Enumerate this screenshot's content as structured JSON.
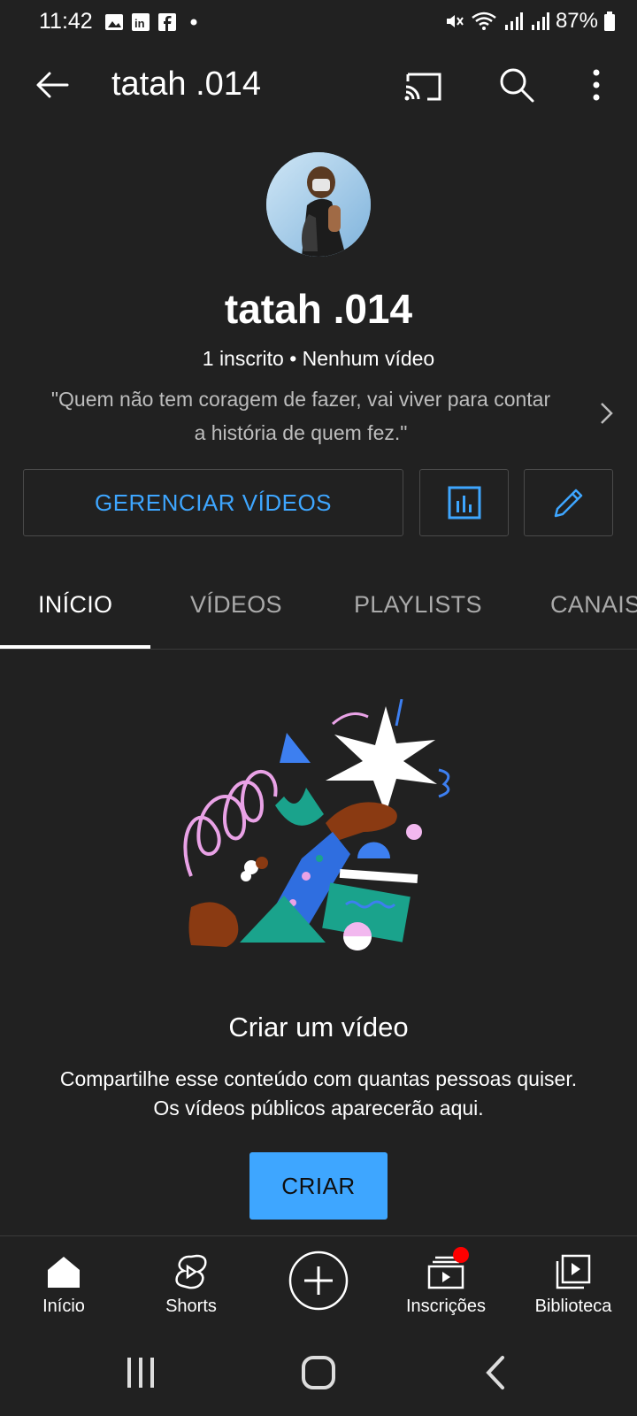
{
  "status_bar": {
    "time": "11:42",
    "battery": "87%",
    "left_icons": [
      "gallery-icon",
      "linkedin-icon",
      "facebook-icon",
      "dot-icon"
    ],
    "right_icons": [
      "mute-icon",
      "wifi-icon",
      "signal-icon",
      "signal-icon",
      "battery-icon"
    ]
  },
  "app_bar": {
    "title": "tatah .014"
  },
  "channel": {
    "name": "tatah .014",
    "meta": "1 inscrito • Nenhum vídeo",
    "description_line1": "\"Quem não tem coragem de fazer, vai viver para contar",
    "description_line2": "a história de quem fez.\""
  },
  "actions": {
    "manage_label": "GERENCIAR VÍDEOS"
  },
  "tabs": [
    {
      "label": "INÍCIO",
      "active": true
    },
    {
      "label": "VÍDEOS",
      "active": false
    },
    {
      "label": "PLAYLISTS",
      "active": false
    },
    {
      "label": "CANAIS",
      "active": false
    }
  ],
  "empty_state": {
    "title": "Criar um vídeo",
    "line1": "Compartilhe esse conteúdo com quantas pessoas quiser.",
    "line2": "Os vídeos públicos aparecerão aqui.",
    "button": "CRIAR"
  },
  "bottom_nav": {
    "items": [
      {
        "label": "Início",
        "icon": "home-icon"
      },
      {
        "label": "Shorts",
        "icon": "shorts-icon"
      },
      {
        "label": "",
        "icon": "create-plus-icon"
      },
      {
        "label": "Inscrições",
        "icon": "subscriptions-icon"
      },
      {
        "label": "Biblioteca",
        "icon": "library-icon"
      }
    ]
  },
  "colors": {
    "background": "#212121",
    "accent": "#3ea6ff",
    "notification": "#ff0000"
  }
}
